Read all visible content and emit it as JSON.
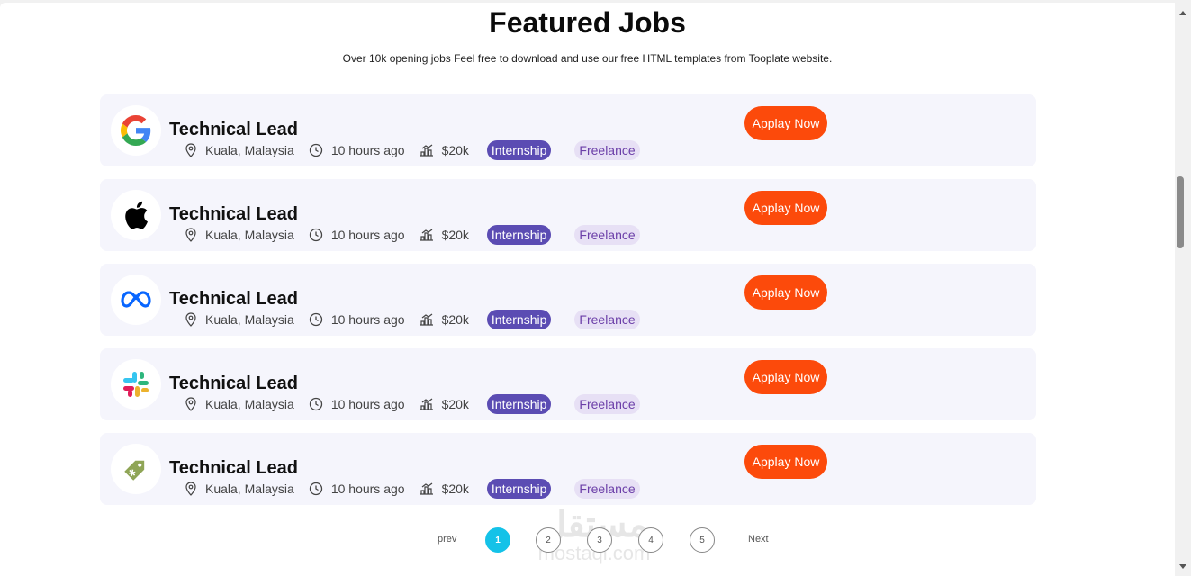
{
  "header": {
    "title": "Featured Jobs",
    "subtitle": "Over 10k opening jobs Feel free to download and use our free HTML templates from Tooplate website."
  },
  "jobs": [
    {
      "company_icon": "google-logo-icon",
      "title": "Technical Lead",
      "location": "Kuala, Malaysia",
      "time": "10 hours ago",
      "salary": "$20k",
      "tag1": "Internship",
      "tag2": "Freelance",
      "apply_label": "Applay Now"
    },
    {
      "company_icon": "apple-logo-icon",
      "title": "Technical Lead",
      "location": "Kuala, Malaysia",
      "time": "10 hours ago",
      "salary": "$20k",
      "tag1": "Internship",
      "tag2": "Freelance",
      "apply_label": "Applay Now"
    },
    {
      "company_icon": "meta-logo-icon",
      "title": "Technical Lead",
      "location": "Kuala, Malaysia",
      "time": "10 hours ago",
      "salary": "$20k",
      "tag1": "Internship",
      "tag2": "Freelance",
      "apply_label": "Applay Now"
    },
    {
      "company_icon": "slack-logo-icon",
      "title": "Technical Lead",
      "location": "Kuala, Malaysia",
      "time": "10 hours ago",
      "salary": "$20k",
      "tag1": "Internship",
      "tag2": "Freelance",
      "apply_label": "Applay Now"
    },
    {
      "company_icon": "tag-logo-icon",
      "title": "Technical Lead",
      "location": "Kuala, Malaysia",
      "time": "10 hours ago",
      "salary": "$20k",
      "tag1": "Internship",
      "tag2": "Freelance",
      "apply_label": "Applay Now"
    }
  ],
  "pagination": {
    "prev": "prev",
    "next": "Next",
    "pages": [
      "1",
      "2",
      "3",
      "4",
      "5"
    ],
    "current": "1"
  },
  "watermark": {
    "main": "مستقل",
    "sub": "mostaql.com"
  },
  "colors": {
    "apply": "#fc4a0b",
    "internship": "#5b4cb3",
    "freelance_bg": "#e7e0f5",
    "pagination_active": "#14c2e8",
    "card_bg": "#f5f5fc"
  }
}
